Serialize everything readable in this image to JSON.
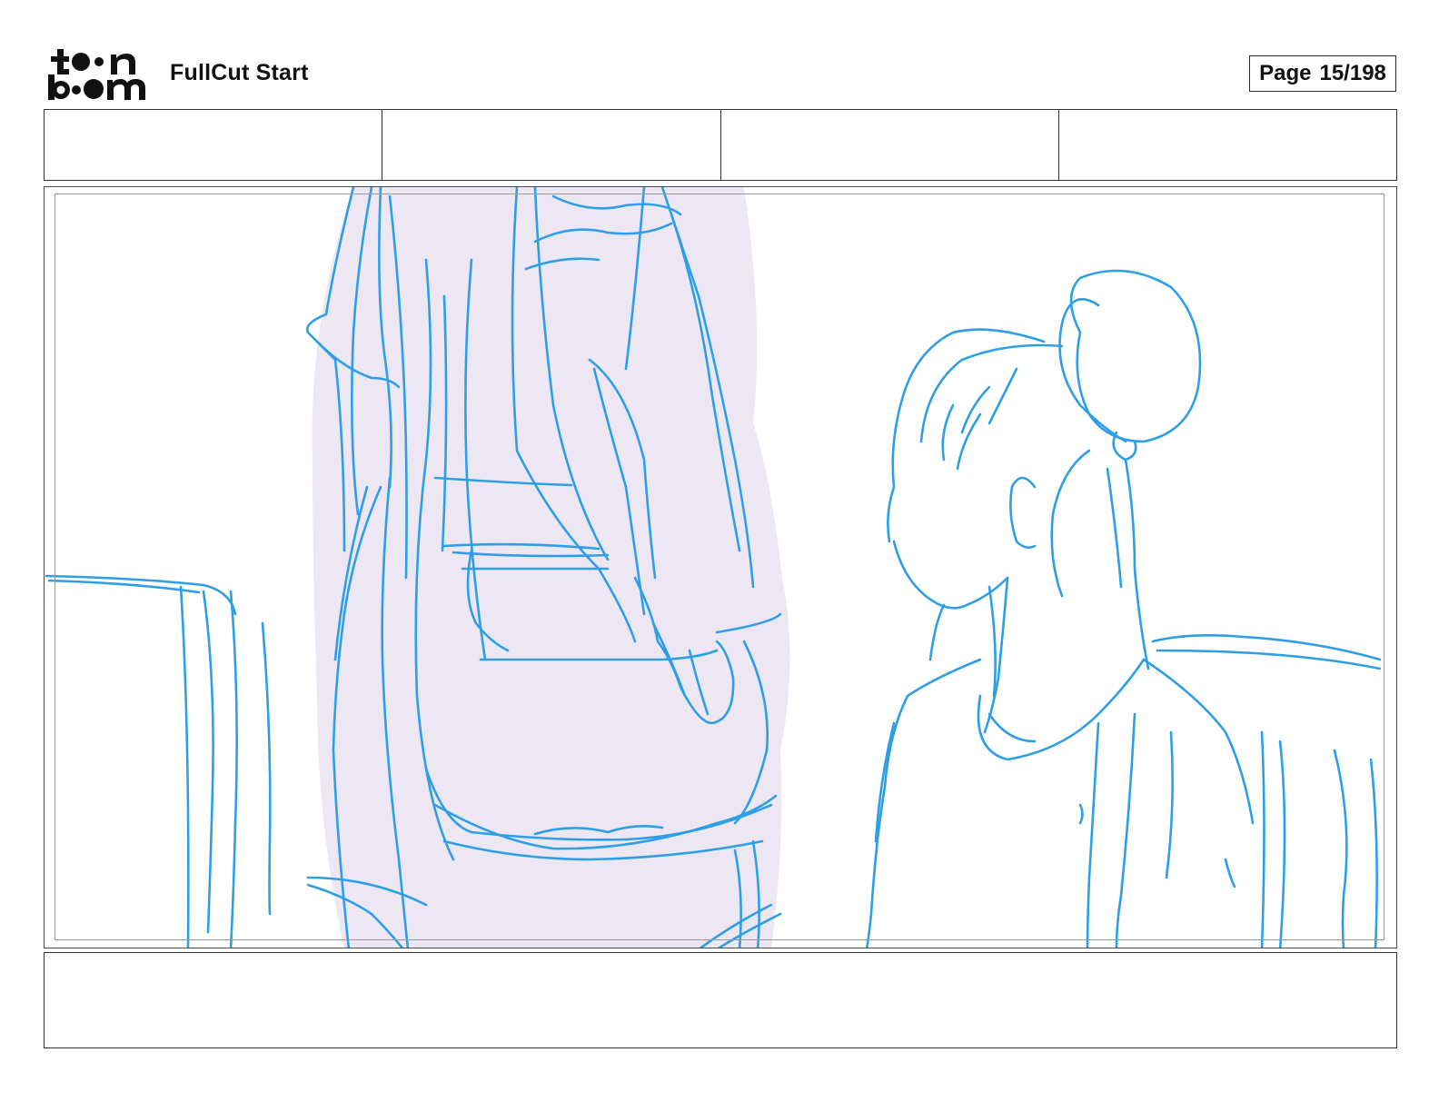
{
  "header": {
    "logo_name": "toon boom",
    "logo_lines": [
      "toon",
      "boom"
    ],
    "project_title": "FullCut Start",
    "page_word": "Page",
    "page_number": "15/198"
  },
  "panel_header": {
    "cells": [
      "",
      "",
      "",
      ""
    ]
  },
  "panel": {
    "sketch_stroke_color": "#2e9fe6",
    "sketch_fill_color": "#ece7f3"
  },
  "dialogue": {
    "text": ""
  }
}
